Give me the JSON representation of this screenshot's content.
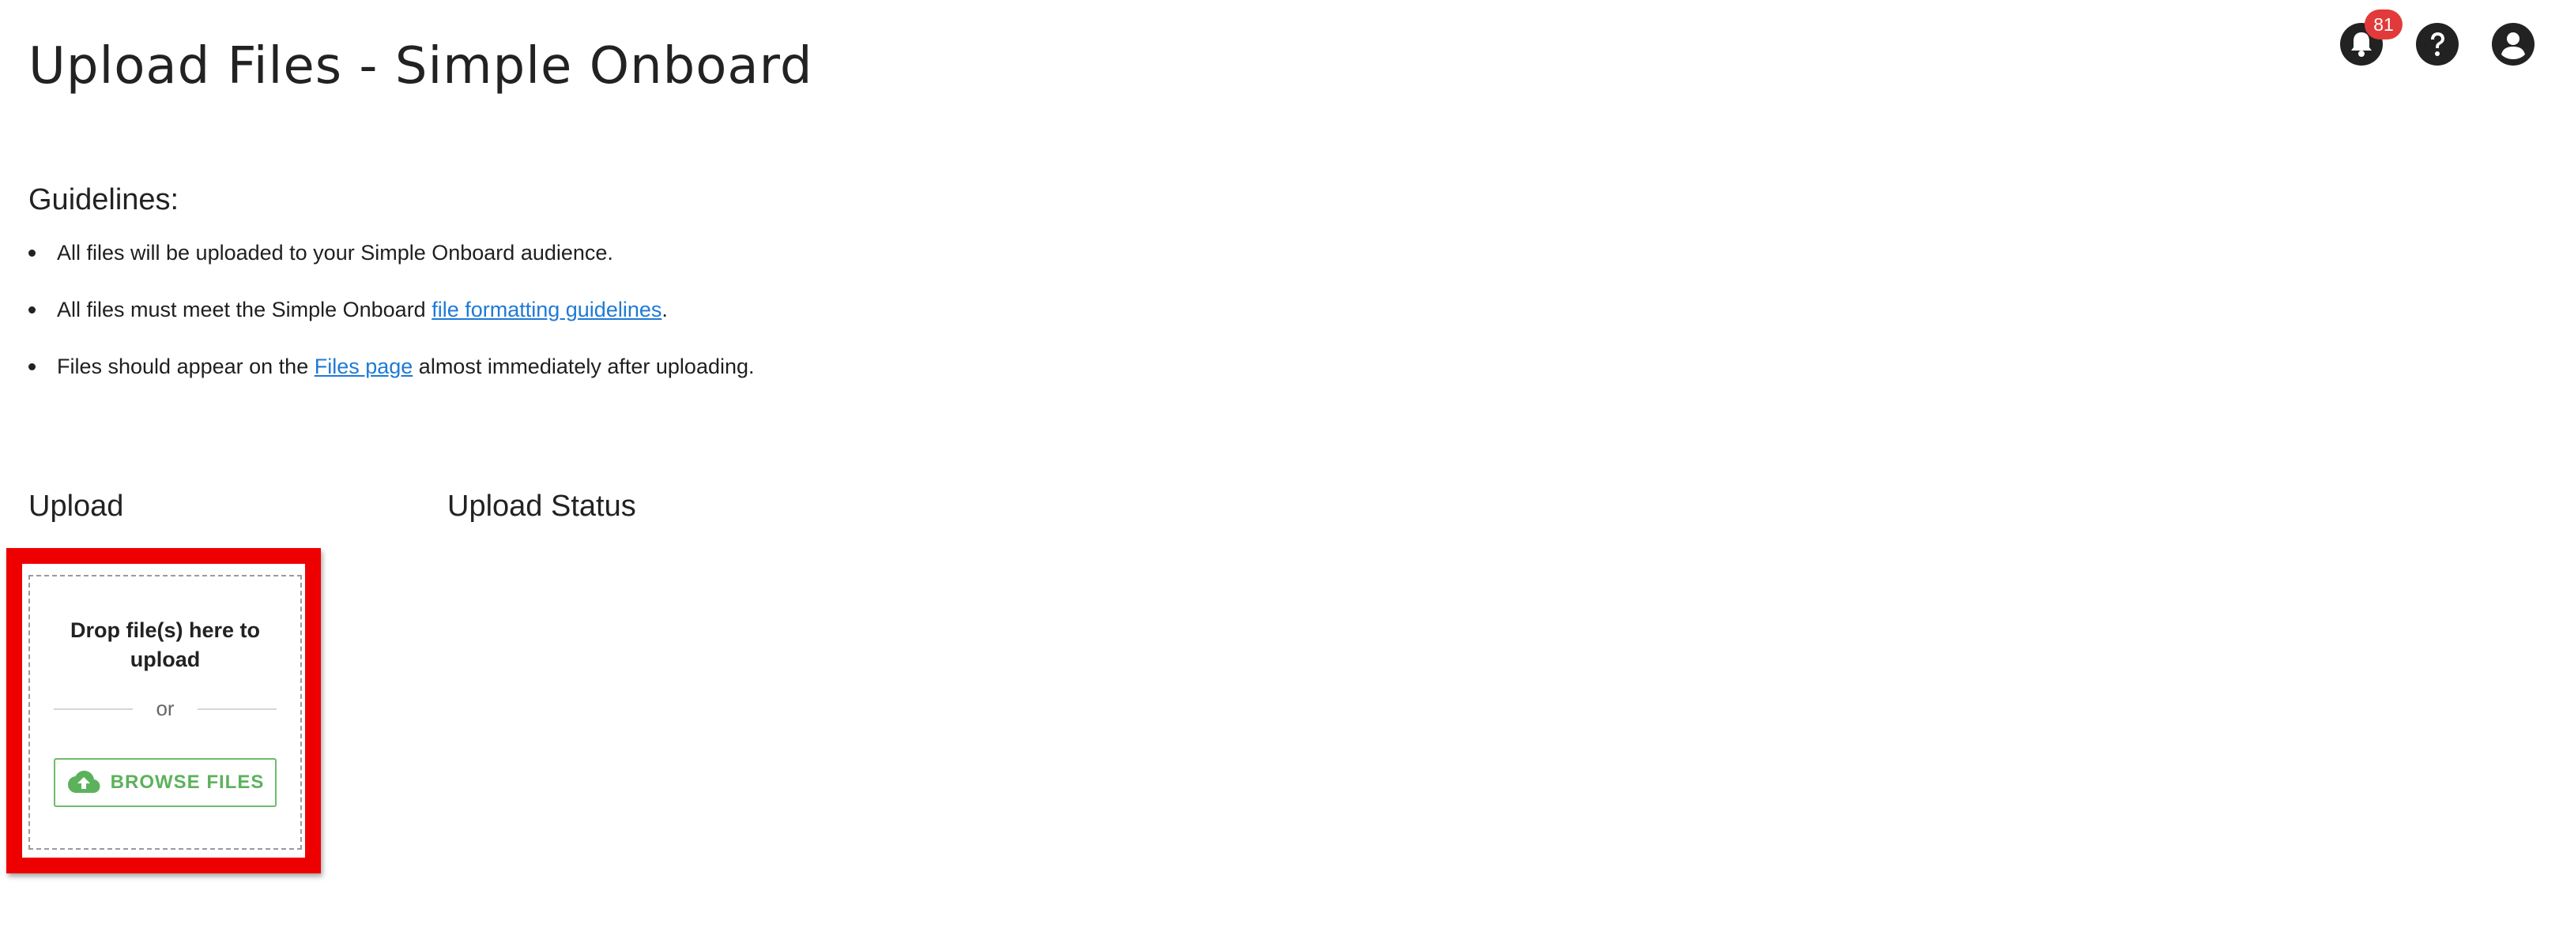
{
  "header": {
    "title": "Upload Files - Simple Onboard",
    "notifications": {
      "count": "81",
      "icon": "bell-icon"
    },
    "help": {
      "icon": "help-icon"
    },
    "account": {
      "icon": "user-icon"
    }
  },
  "guidelines": {
    "heading": "Guidelines:",
    "items": [
      {
        "text": "All files will be uploaded to your Simple Onboard audience."
      },
      {
        "text_before": "All files must meet the Simple Onboard ",
        "link": "file formatting guidelines",
        "text_after": "."
      },
      {
        "text_before": "Files should appear on the ",
        "link": "Files page",
        "text_after": " almost immediately after uploading."
      }
    ]
  },
  "upload": {
    "heading": "Upload",
    "dropzone_text": "Drop file(s) here to upload",
    "or_text": "or",
    "browse_label": "BROWSE FILES",
    "browse_icon": "cloud-upload-icon"
  },
  "upload_status": {
    "heading": "Upload Status"
  },
  "colors": {
    "link": "#1e7ad6",
    "badge": "#e23a3a",
    "browse_accent": "#5cb25c",
    "highlight": "#ee0000"
  }
}
